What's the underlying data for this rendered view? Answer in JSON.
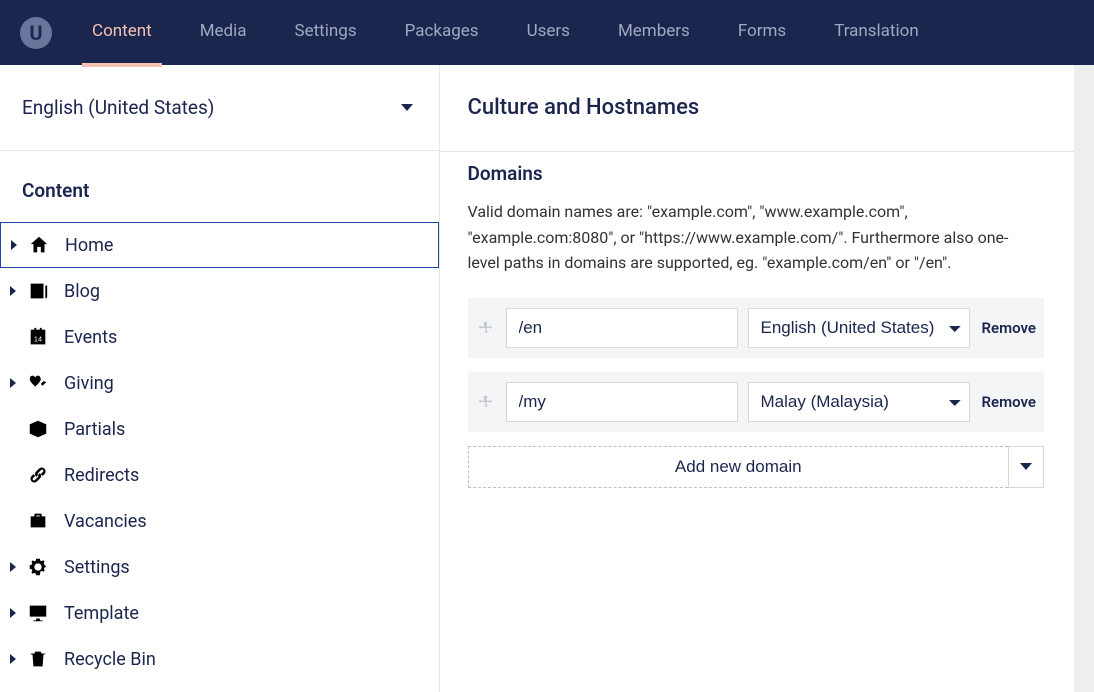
{
  "topnav": {
    "items": [
      "Content",
      "Media",
      "Settings",
      "Packages",
      "Users",
      "Members",
      "Forms",
      "Translation"
    ],
    "active_index": 0
  },
  "sidebar": {
    "language": "English (United States)",
    "heading": "Content",
    "tree": [
      {
        "label": "Home",
        "icon": "home",
        "expandable": true,
        "selected": true
      },
      {
        "label": "Blog",
        "icon": "newspaper",
        "expandable": true,
        "selected": false
      },
      {
        "label": "Events",
        "icon": "calendar",
        "expandable": false,
        "selected": false
      },
      {
        "label": "Giving",
        "icon": "hands",
        "expandable": true,
        "selected": false
      },
      {
        "label": "Partials",
        "icon": "box",
        "expandable": false,
        "selected": false
      },
      {
        "label": "Redirects",
        "icon": "link",
        "expandable": false,
        "selected": false
      },
      {
        "label": "Vacancies",
        "icon": "briefcase",
        "expandable": false,
        "selected": false
      },
      {
        "label": "Settings",
        "icon": "gear",
        "expandable": true,
        "selected": false
      },
      {
        "label": "Template",
        "icon": "monitor",
        "expandable": true,
        "selected": false
      },
      {
        "label": "Recycle Bin",
        "icon": "trash",
        "expandable": true,
        "selected": false
      }
    ]
  },
  "main": {
    "title": "Culture and Hostnames",
    "section_title": "Domains",
    "help_text": "Valid domain names are: \"example.com\", \"www.example.com\", \"example.com:8080\", or \"https://www.example.com/\". Furthermore also one-level paths in domains are supported, eg. \"example.com/en\" or \"/en\".",
    "language_options": [
      "English (United States)",
      "Malay (Malaysia)"
    ],
    "domains": [
      {
        "path": "/en",
        "language": "English (United States)"
      },
      {
        "path": "/my",
        "language": "Malay (Malaysia)"
      }
    ],
    "remove_label": "Remove",
    "add_label": "Add new domain"
  }
}
